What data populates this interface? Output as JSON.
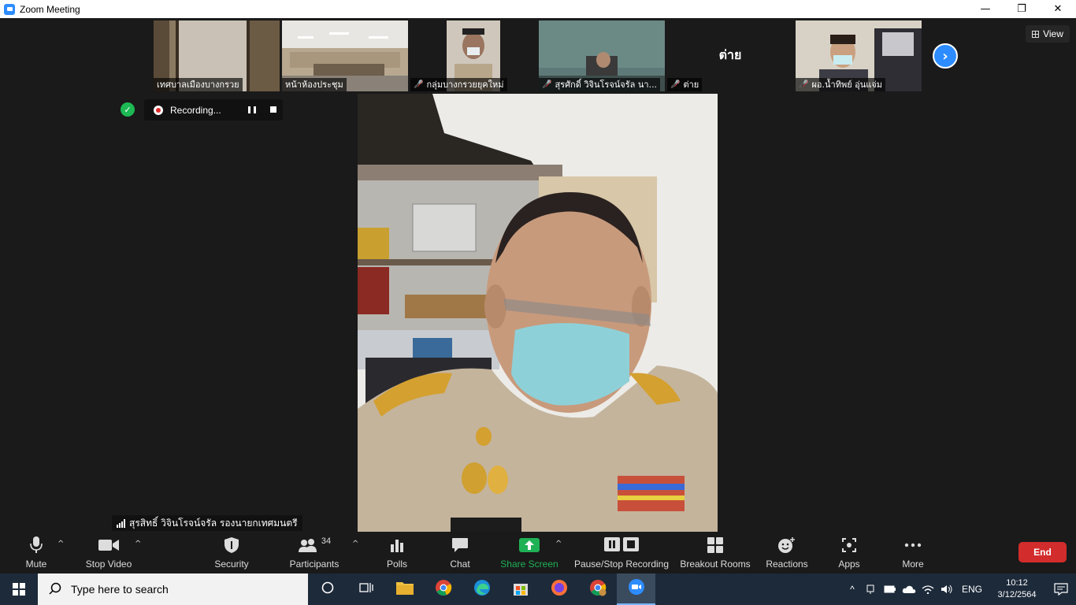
{
  "window": {
    "title": "Zoom Meeting",
    "minimize": "—",
    "restore": "❐",
    "close": "✕"
  },
  "thumbnails": [
    {
      "label": "เทศบาลเมืองบางกรวย",
      "muted": false
    },
    {
      "label": "หน้าห้องประชุม",
      "muted": false
    },
    {
      "label": "กลุ่มบางกรวยยุคใหม่",
      "muted": true
    },
    {
      "label": "สุรศักดิ์ วิจินโรจน์จรัล นา...",
      "muted": true
    },
    {
      "label": "ต่าย",
      "muted": true,
      "big_name": "ต่าย"
    },
    {
      "label": "ผอ.น้ำทิพย์ อุ่นแจ่ม",
      "muted": true
    }
  ],
  "view_button": "View",
  "recording": {
    "label": "Recording..."
  },
  "active_speaker": {
    "name": "สุรสิทธิ์ วิจินโรจน์จรัล รองนายกเทศมนตรี"
  },
  "toolbar": {
    "mute": "Mute",
    "stop_video": "Stop Video",
    "security": "Security",
    "participants": "Participants",
    "participants_count": "34",
    "polls": "Polls",
    "chat": "Chat",
    "share_screen": "Share Screen",
    "recording": "Pause/Stop Recording",
    "breakout_rooms": "Breakout Rooms",
    "reactions": "Reactions",
    "apps": "Apps",
    "more": "More",
    "end": "End"
  },
  "taskbar": {
    "search_placeholder": "Type here to search",
    "language": "ENG",
    "time": "10:12",
    "date": "3/12/2564"
  },
  "colors": {
    "zoom_blue": "#2d8cff",
    "share_green": "#1fb155",
    "end_red": "#d22c2c",
    "background": "#1a1a1a"
  }
}
